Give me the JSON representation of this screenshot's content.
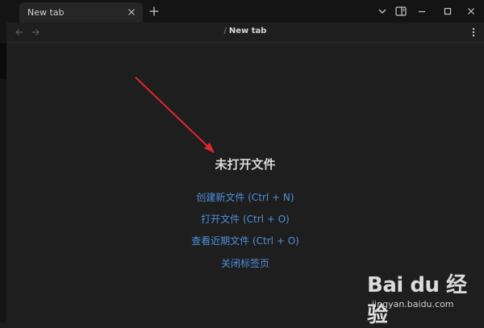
{
  "tab": {
    "title": "New tab"
  },
  "icons": {
    "close": "close-icon",
    "new_tab": "plus-icon",
    "dropdown": "chevron-down-icon",
    "sidebar_toggle": "sidebar-layout-icon",
    "minimize": "minimize-icon",
    "maximize": "maximize-icon",
    "window_close": "window-close-icon",
    "back": "arrow-left-icon",
    "forward": "arrow-right-icon",
    "more": "more-vertical-icon"
  },
  "breadcrumb": {
    "separator": "/",
    "current": "New tab"
  },
  "empty_state": {
    "title": "未打开文件",
    "actions": [
      {
        "label": "创建新文件 (Ctrl + N)"
      },
      {
        "label": "打开文件 (Ctrl + O)"
      },
      {
        "label": "查看近期文件 (Ctrl + O)"
      },
      {
        "label": "关闭标签页"
      }
    ]
  },
  "annotation": {
    "color": "#e0262e"
  },
  "colors": {
    "link": "#4f8fdc",
    "background": "#1e1e1e",
    "titlebar": "#141414"
  },
  "watermark": {
    "logo": "Bai du 经验",
    "url": "jingyan.baidu.com"
  }
}
